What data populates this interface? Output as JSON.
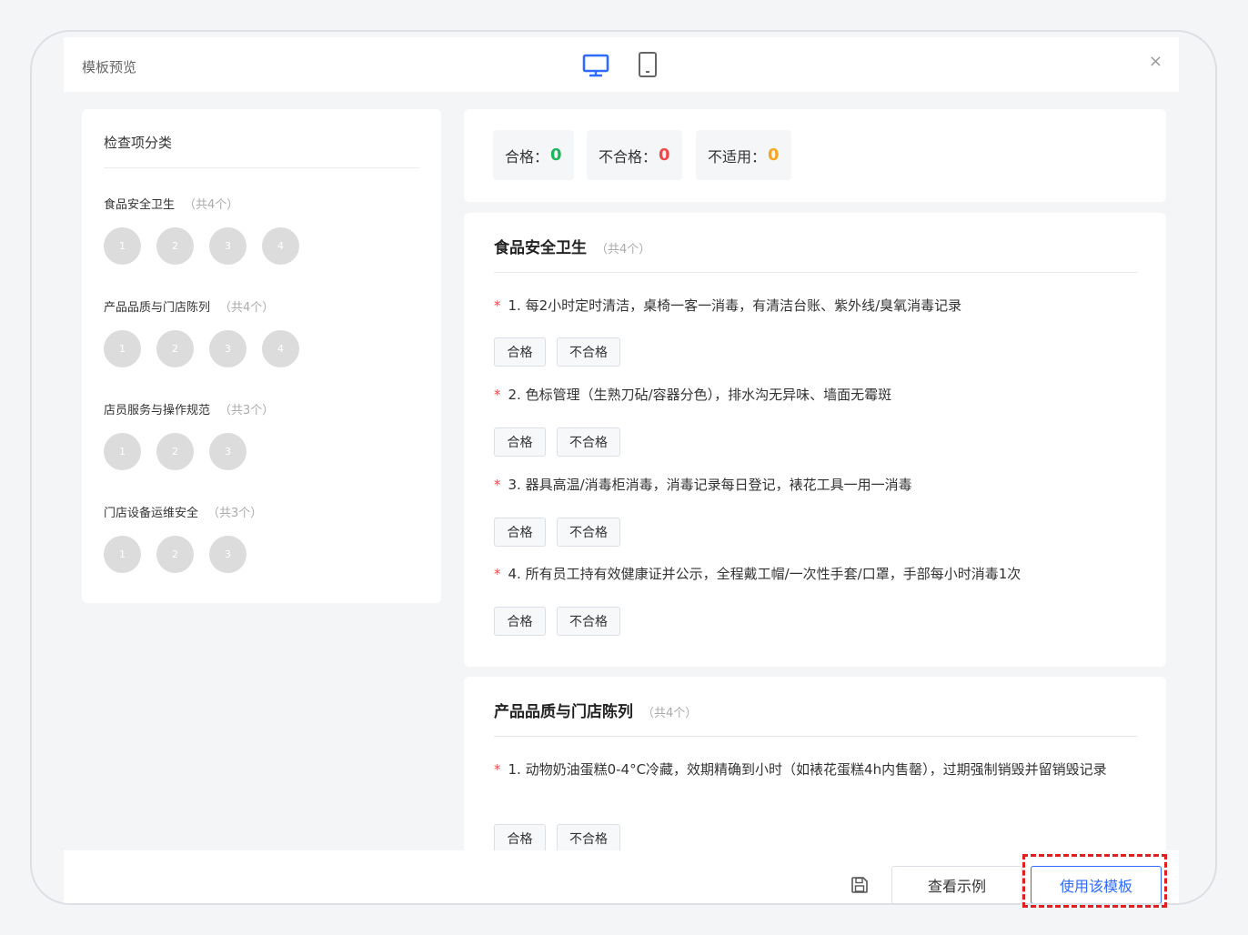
{
  "header": {
    "title": "模板预览",
    "device_desktop_icon": "desktop-icon",
    "device_mobile_icon": "mobile-icon",
    "close_label": "×"
  },
  "sidebar": {
    "title": "检查项分类",
    "categories": [
      {
        "name": "食品安全卫生",
        "count": "（共4个）",
        "items": [
          "1",
          "2",
          "3",
          "4"
        ]
      },
      {
        "name": "产品品质与门店陈列",
        "count": "（共4个）",
        "items": [
          "1",
          "2",
          "3",
          "4"
        ]
      },
      {
        "name": "店员服务与操作规范",
        "count": "（共3个）",
        "items": [
          "1",
          "2",
          "3"
        ]
      },
      {
        "name": "门店设备运维安全",
        "count": "（共3个）",
        "items": [
          "1",
          "2",
          "3"
        ]
      }
    ]
  },
  "stats": {
    "pass_label": "合格：",
    "pass_value": "0",
    "fail_label": "不合格：",
    "fail_value": "0",
    "na_label": "不适用：",
    "na_value": "0",
    "colors": {
      "pass": "#1bb55c",
      "fail": "#f04848",
      "na": "#f5a623"
    }
  },
  "sections": [
    {
      "title": "食品安全卫生",
      "count": "（共4个）",
      "items": [
        {
          "required": "*",
          "text": "1. 每2小时定时清洁，桌椅一客一消毒，有清洁台账、紫外线/臭氧消毒记录",
          "pass": "合格",
          "fail": "不合格"
        },
        {
          "required": "*",
          "text": "2. 色标管理（生熟刀砧/容器分色），排水沟无异味、墙面无霉斑",
          "pass": "合格",
          "fail": "不合格"
        },
        {
          "required": "*",
          "text": "3. 器具高温/消毒柜消毒，消毒记录每日登记，裱花工具一用一消毒",
          "pass": "合格",
          "fail": "不合格"
        },
        {
          "required": "*",
          "text": "4. 所有员工持有效健康证并公示，全程戴工帽/一次性手套/口罩，手部每小时消毒1次",
          "pass": "合格",
          "fail": "不合格"
        }
      ]
    },
    {
      "title": "产品品质与门店陈列",
      "count": "（共4个）",
      "items": [
        {
          "required": "*",
          "text": "1. 动物奶油蛋糕0-4°C冷藏，效期精确到小时（如裱花蛋糕4h内售罄），过期强制销毁并留销毁记录",
          "pass": "合格",
          "fail": "不合格"
        }
      ]
    }
  ],
  "footer": {
    "save_icon": "save-icon",
    "example_label": "查看示例",
    "use_label": "使用该模板"
  }
}
